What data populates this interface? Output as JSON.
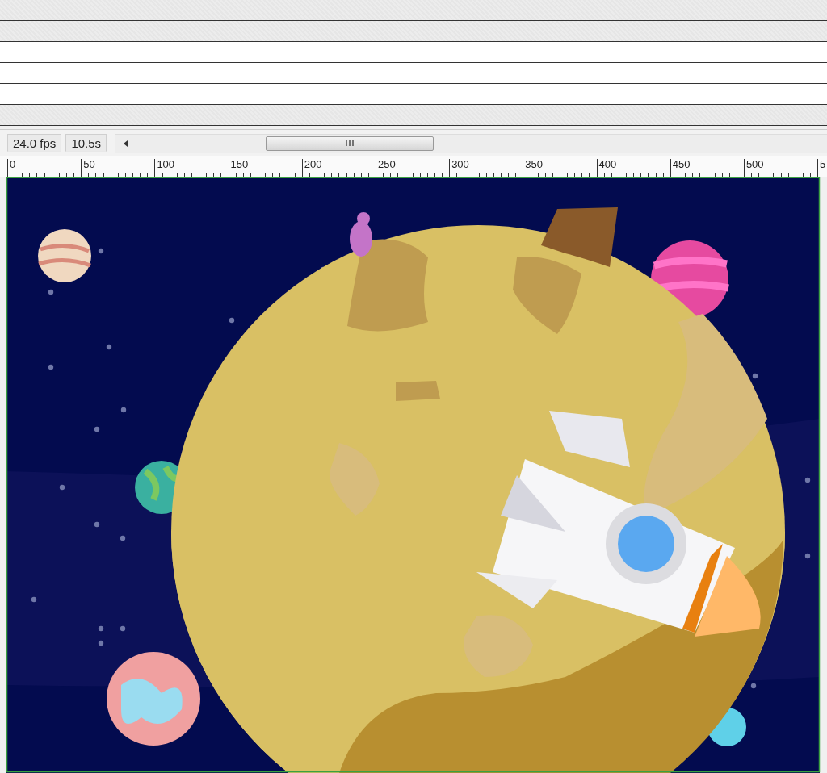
{
  "status_bar": {
    "frame_rate": "24.0 fps",
    "elapsed_time": "10.5s"
  },
  "ruler": {
    "labels": [
      "0",
      "50",
      "100",
      "150",
      "200",
      "250",
      "300",
      "350",
      "400",
      "450",
      "500",
      "5"
    ]
  }
}
